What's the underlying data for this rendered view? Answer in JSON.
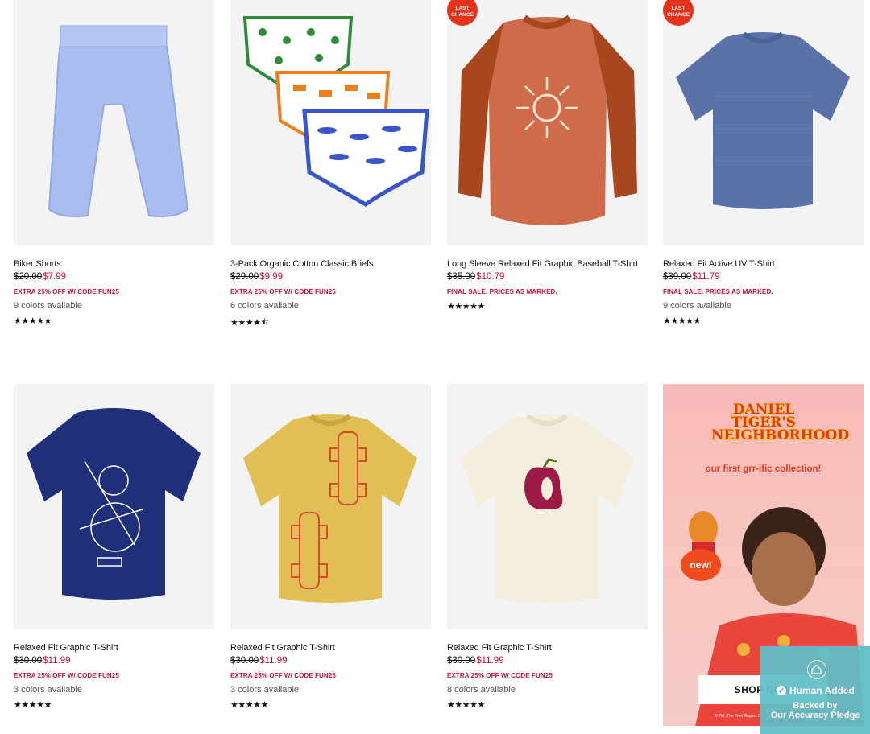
{
  "products": [
    {
      "name": "Biker Shorts",
      "old_price": "$20.00",
      "new_price": "$7.99",
      "promo": "EXTRA 25% OFF W/ CODE FUN25",
      "colors": "9 colors available",
      "stars": "★★★★★",
      "badge": "",
      "badge2": ""
    },
    {
      "name": "3-Pack Organic Cotton Classic Briefs",
      "old_price": "$29.00",
      "new_price": "$9.99",
      "promo": "EXTRA 25% OFF W/ CODE FUN25",
      "colors": "6 colors available",
      "stars": "★★★★⯪",
      "badge": "",
      "badge2": ""
    },
    {
      "name": "Long Sleeve Relaxed Fit Graphic Baseball T-Shirt",
      "old_price": "$35.00",
      "new_price": "$10.79",
      "promo": "FINAL SALE. PRICES AS MARKED.",
      "colors": "",
      "stars": "★★★★★",
      "badge": "LAST",
      "badge2": "CHANCE"
    },
    {
      "name": "Relaxed Fit Active UV T-Shirt",
      "old_price": "$39.00",
      "new_price": "$11.79",
      "promo": "FINAL SALE. PRICES AS MARKED.",
      "colors": "9 colors available",
      "stars": "★★★★★",
      "badge": "LAST",
      "badge2": "CHANCE"
    },
    {
      "name": "Relaxed Fit Graphic T-Shirt",
      "old_price": "$30.00",
      "new_price": "$11.99",
      "promo": "EXTRA 25% OFF W/ CODE FUN25",
      "colors": "3 colors available",
      "stars": "★★★★★",
      "badge": "",
      "badge2": ""
    },
    {
      "name": "Relaxed Fit Graphic T-Shirt",
      "old_price": "$30.00",
      "new_price": "$11.99",
      "promo": "EXTRA 25% OFF W/ CODE FUN25",
      "colors": "3 colors available",
      "stars": "★★★★★",
      "badge": "",
      "badge2": ""
    },
    {
      "name": "Relaxed Fit Graphic T-Shirt",
      "old_price": "$30.00",
      "new_price": "$11.99",
      "promo": "EXTRA 25% OFF W/ CODE FUN25",
      "colors": "8 colors available",
      "stars": "★★★★★",
      "badge": "",
      "badge2": ""
    }
  ],
  "promo_tile": {
    "title": "DANIEL TIGER'S NEIGHBORHOOD",
    "subtitle": "our first grr-ific collection!",
    "new_label": "new!",
    "button": "SHOP NOW",
    "fine_print": "© TM, The Fred Rogers Co."
  },
  "human_added": {
    "title": "Human Added",
    "line1": "Backed by",
    "line2": "Our Accuracy Pledge"
  },
  "colors": {
    "sale_red": "#c8102e",
    "badge_red": "#e4321b",
    "widget_teal": "#5fbfc8"
  },
  "icons": [
    "home-icon",
    "check-icon",
    "star-icon"
  ]
}
